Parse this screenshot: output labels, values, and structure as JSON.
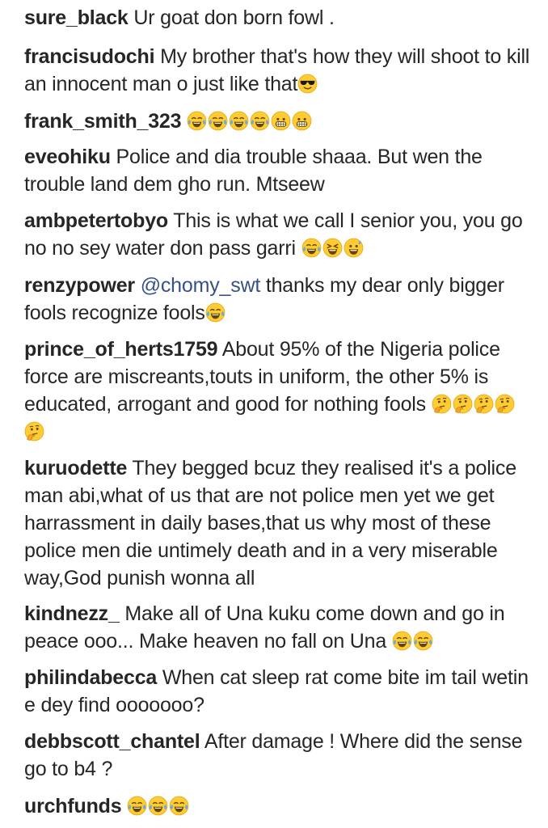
{
  "comments": [
    {
      "username": "sure_black",
      "text": "Ur goat don born fowl .",
      "emojis": []
    },
    {
      "username": "francisudochi",
      "text": "My brother that's how they will shoot to kill an innocent man o just like that",
      "emojis": [
        "sunglasses-face"
      ]
    },
    {
      "username": "frank_smith_323",
      "text": "",
      "emojis": [
        "tears-of-joy",
        "tears-of-joy",
        "tears-of-joy",
        "tears-of-joy",
        "grinning-face",
        "grinning-face"
      ]
    },
    {
      "username": "eveohiku",
      "text": "Police and dia trouble shaaa. But wen the trouble land dem gho run. Mtseew",
      "emojis": []
    },
    {
      "username": "ambpetertobyo",
      "text": "This is what we call I senior you, you go no no sey water don pass garri",
      "emojis": [
        "tears-of-joy",
        "squinting-laugh",
        "sweat-smile"
      ]
    },
    {
      "username": "renzypower",
      "mention": "@chomy_swt",
      "text": "thanks my dear only bigger fools recognize fools",
      "emojis": [
        "tears-of-joy"
      ]
    },
    {
      "username": "prince_of_herts1759",
      "text": "About 95% of the Nigeria police force are miscreants,touts in uniform, the other 5% is educated, arrogant and good for nothing fools",
      "emojis": [
        "thinking-face",
        "thinking-face",
        "thinking-face",
        "thinking-face",
        "thinking-face"
      ]
    },
    {
      "username": "kuruodette",
      "text": "They begged bcuz they realised it's a police man abi,what of us that are not police men yet we get harrassment in daily bases,that us why most of these police men die untimely death and in a very miserable way,God punish wonna all",
      "emojis": []
    },
    {
      "username": "kindnezz_",
      "text": "Make all of Una kuku come down and go in peace ooo... Make heaven no fall on Una",
      "emojis": [
        "tears-of-joy",
        "tears-of-joy"
      ]
    },
    {
      "username": "philindabecca",
      "text": "When cat sleep rat come bite im tail wetin e dey find ooooooo?",
      "emojis": []
    },
    {
      "username": "debbscott_chantel",
      "text": "After damage ! Where did the sense go to b4 ?",
      "emojis": []
    },
    {
      "username": "urchfunds",
      "text": "",
      "emojis": [
        "tears-of-joy",
        "tears-of-joy",
        "tears-of-joy"
      ]
    }
  ]
}
